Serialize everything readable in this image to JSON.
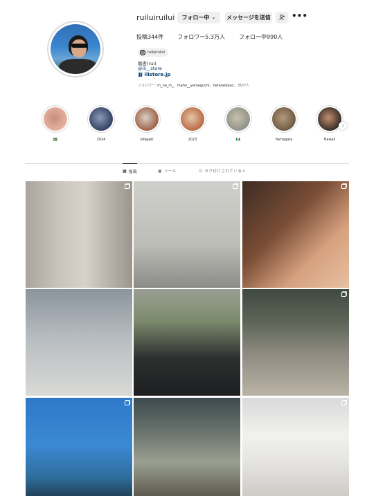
{
  "profile": {
    "username": "ruiluiruilui",
    "follow_button": "フォロー中",
    "message_button": "メッセージを送信",
    "add_user_icon": "add-user-icon",
    "more_icon": "more-icon",
    "more_glyph": "•••",
    "chevron": "⌄",
    "stats": {
      "posts": "投稿344件",
      "followers": "フォロワー5.3万人",
      "following": "フォロー中990人"
    },
    "threads_handle": "ruiluiruilui",
    "bio_name": "堀杏(rui)",
    "bio_link1": "@ili__store",
    "bio_link2": "ilistore.jp",
    "followed_by": {
      "prefix": "フォロワー:",
      "names": "m_na_m_、maho__yamaguchi、netanedayo、",
      "suffix": "他37人"
    }
  },
  "highlights": [
    {
      "label": "🇸🇪",
      "color1": "#e8b7a4",
      "color2": "#c98d7c"
    },
    {
      "label": "2024",
      "color1": "#2f3b5c",
      "color2": "#8a9bb8"
    },
    {
      "label": "Ishigaki",
      "color1": "#9b5a3e",
      "color2": "#d8cfc5"
    },
    {
      "label": "2023",
      "color1": "#b5643f",
      "color2": "#e6c6a8"
    },
    {
      "label": "🇮🇹",
      "color1": "#8b8f84",
      "color2": "#c9c1ae"
    },
    {
      "label": "Yamagata",
      "color1": "#6d5640",
      "color2": "#b19a7c"
    },
    {
      "label": "Hawaii",
      "color1": "#2a2623",
      "color2": "#c48f6e"
    }
  ],
  "tabs": [
    {
      "label": "投稿",
      "icon": "grid-icon",
      "glyph": "▦",
      "active": true
    },
    {
      "label": "リール",
      "icon": "reels-icon",
      "glyph": "▣",
      "active": false
    },
    {
      "label": "タグ付けされている人",
      "icon": "tagged-icon",
      "glyph": "⊡",
      "active": false
    }
  ],
  "posts": [
    {
      "bg": "linear-gradient(90deg,#a9a59c 0%,#c7c3ba 30%,#d7d3ca 55%,#9b968c 100%)",
      "multi": true
    },
    {
      "bg": "linear-gradient(180deg,#cfcfcb 0%,#bdbdb8 60%,#8a8a86 100%)",
      "multi": true
    },
    {
      "bg": "linear-gradient(135deg,#3d2c24 0%,#7a4d35 40%,#d6a17f 70%,#e7c0a2 100%)",
      "multi": true
    },
    {
      "bg": "linear-gradient(180deg,#8b949c 0%,#b7bcc0 45%,#d9dad7 100%)",
      "multi": false
    },
    {
      "bg": "linear-gradient(180deg,#9a9e92 0%,#7c8a6d 30%,#2d2f2f 65%,#1d1e20 100%)",
      "multi": false
    },
    {
      "bg": "linear-gradient(180deg,#3f4a3f 0%,#5c6457 30%,#8e8a80 60%,#bbb4a6 100%)",
      "multi": true
    },
    {
      "bg": "linear-gradient(180deg,#2f79c9 0%,#3b89d3 45%,#2e6d9b 75%,#1d2f3c 100%)",
      "multi": true
    },
    {
      "bg": "linear-gradient(180deg,#3c4a4f 0%,#6f7770 35%,#9aa090 60%,#4f4a40 100%)",
      "multi": false
    },
    {
      "bg": "linear-gradient(180deg,#d9d9d9 0%,#f1f1ef 35%,#e5e4e1 60%,#c9c6c1 100%)",
      "multi": true
    }
  ]
}
